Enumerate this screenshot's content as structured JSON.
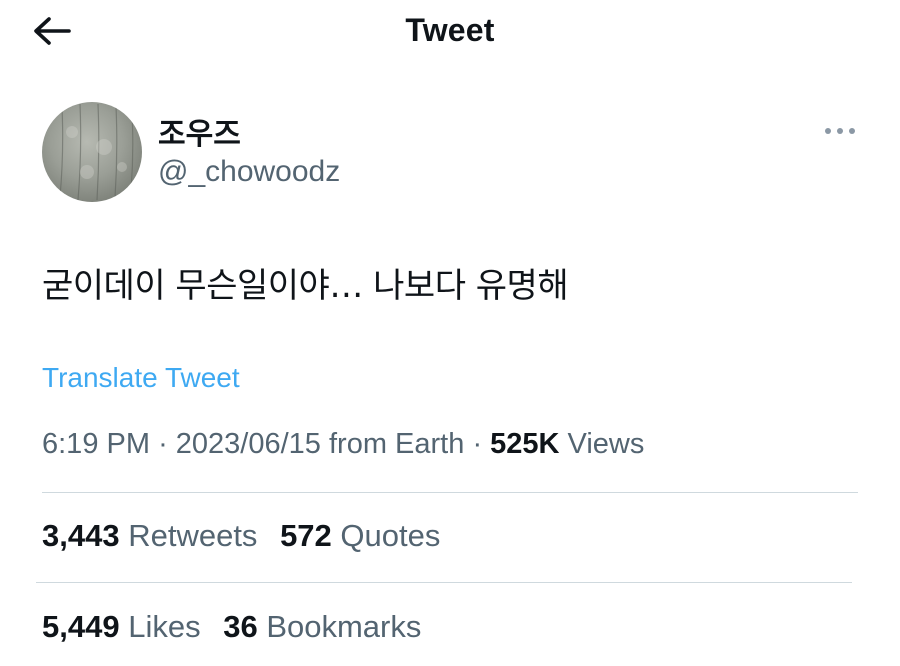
{
  "header": {
    "title": "Tweet",
    "back_icon": "arrow-left-icon"
  },
  "author": {
    "name": "조우즈",
    "handle": "@_chowoodz",
    "more_icon": "more-horizontal-icon"
  },
  "tweet": {
    "text": "굳이데이 무슨일이야… 나보다 유명해",
    "translate_label": "Translate Tweet"
  },
  "meta": {
    "time": "6:19 PM",
    "date": "2023/06/15",
    "source": "from Earth",
    "views_count": "525K",
    "views_label": "Views"
  },
  "stats": {
    "retweets_count": "3,443",
    "retweets_label": "Retweets",
    "quotes_count": "572",
    "quotes_label": "Quotes",
    "likes_count": "5,449",
    "likes_label": "Likes",
    "bookmarks_count": "36",
    "bookmarks_label": "Bookmarks"
  },
  "colors": {
    "link": "#1d9bf0",
    "secondary_text": "#536471",
    "primary_text": "#0f1419",
    "divider": "#cfd9de"
  }
}
